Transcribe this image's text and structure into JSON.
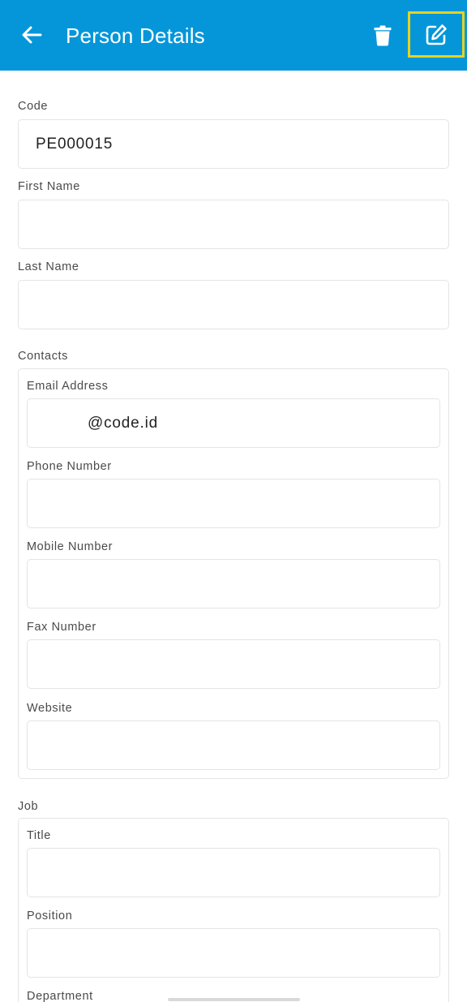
{
  "header": {
    "title": "Person Details",
    "back_icon": "arrow-left-icon",
    "delete_icon": "trash-icon",
    "edit_icon": "edit-icon",
    "color": "#0496d9",
    "highlight_color": "#e7d21f"
  },
  "fields": {
    "code": {
      "label": "Code",
      "value": "PE000015"
    },
    "first_name": {
      "label": "First Name",
      "value": ""
    },
    "last_name": {
      "label": "Last Name",
      "value": ""
    }
  },
  "contacts": {
    "section_label": "Contacts",
    "email": {
      "label": "Email Address",
      "value": "@code.id"
    },
    "phone": {
      "label": "Phone Number",
      "value": ""
    },
    "mobile": {
      "label": "Mobile Number",
      "value": ""
    },
    "fax": {
      "label": "Fax Number",
      "value": ""
    },
    "website": {
      "label": "Website",
      "value": ""
    }
  },
  "job": {
    "section_label": "Job",
    "title": {
      "label": "Title",
      "value": ""
    },
    "position": {
      "label": "Position",
      "value": ""
    },
    "department": {
      "label": "Department"
    }
  }
}
